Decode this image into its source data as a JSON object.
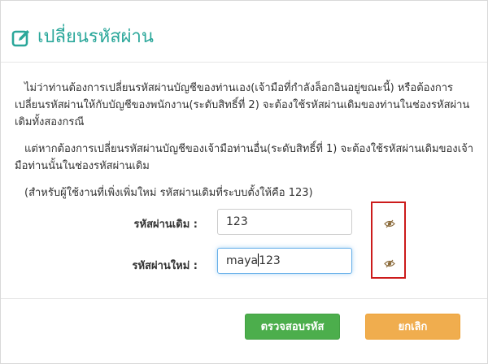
{
  "dialog": {
    "title": "เปลี่ยนรหัสผ่าน",
    "title_color": "#2aa79a"
  },
  "body": {
    "paragraph_1": "ไม่ว่าท่านต้องการเปลี่ยนรหัสผ่านบัญชีของท่านเอง(เจ้ามือที่กำลังล็อกอินอยู่ขณะนี้) หรือต้องการเปลี่ยนรหัสผ่านให้กับบัญชีของพนักงาน(ระดับสิทธิ์ที่ 2) จะต้องใช้รหัสผ่านเดิมของท่านในช่องรหัสผ่านเดิมทั้งสองกรณี",
    "paragraph_2": "แต่หากต้องการเปลี่ยนรหัสผ่านบัญชีของเจ้ามือท่านอื่น(ระดับสิทธิ์ที่ 1) จะต้องใช้รหัสผ่านเดิมของเจ้ามือท่านนั้นในช่องรหัสผ่านเดิม",
    "paragraph_3": "(สำหรับผู้ใช้งานที่เพิ่งเพิ่มใหม่ รหัสผ่านเดิมที่ระบบตั้งให้คือ 123)"
  },
  "form": {
    "old_password_label": "รหัสผ่านเดิม :",
    "old_password_value": "123",
    "new_password_label": "รหัสผ่านใหม่ :",
    "new_password_value_before_caret": "maya",
    "new_password_value_after_caret": "123",
    "toggle_icon": "eye-slash-icon"
  },
  "footer": {
    "check_button_label": "ตรวจสอบรหัส",
    "check_button_color": "#4cae4c",
    "cancel_button_label": "ยกเลิก",
    "cancel_button_color": "#f0ad4e"
  },
  "highlight_color": "#cc1b1b"
}
